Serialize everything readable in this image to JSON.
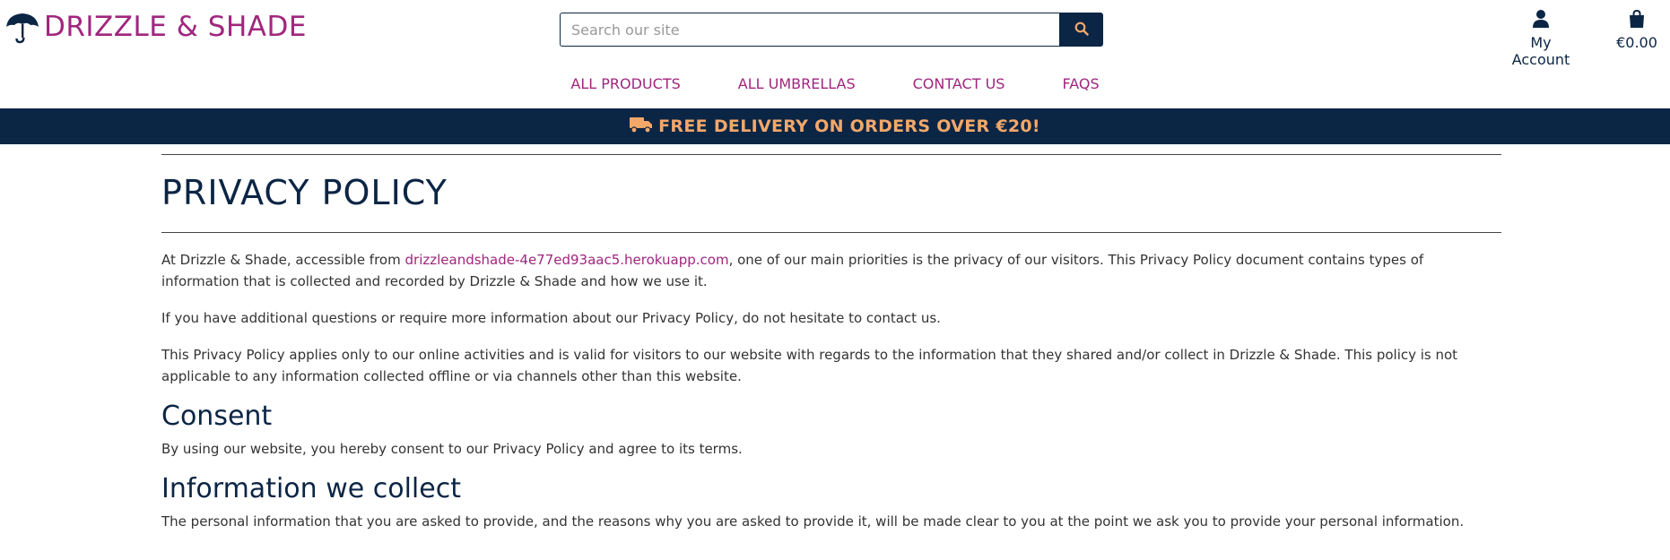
{
  "brand": {
    "name": "DRIZZLE & SHADE",
    "color": "#a0267e"
  },
  "search": {
    "placeholder": "Search our site",
    "value": ""
  },
  "account": {
    "label": "My Account"
  },
  "bag": {
    "total": "€0.00"
  },
  "nav": {
    "items": [
      {
        "label": "ALL PRODUCTS"
      },
      {
        "label": "ALL UMBRELLAS"
      },
      {
        "label": "CONTACT US"
      },
      {
        "label": "FAQS"
      }
    ]
  },
  "banner": {
    "text": "FREE DELIVERY ON ORDERS OVER €20!",
    "icon": "truck-icon"
  },
  "page": {
    "title": "PRIVACY POLICY",
    "intro": {
      "before_link": "At Drizzle & Shade, accessible from ",
      "link": "drizzleandshade-4e77ed93aac5.herokuapp.com",
      "after_link": ", one of our main priorities is the privacy of our visitors. This Privacy Policy document contains types of information that is collected and recorded by Drizzle & Shade and how we use it."
    },
    "para2": "If you have additional questions or require more information about our Privacy Policy, do not hesitate to contact us.",
    "para3": "This Privacy Policy applies only to our online activities and is valid for visitors to our website with regards to the information that they shared and/or collect in Drizzle & Shade. This policy is not applicable to any information collected offline or via channels other than this website.",
    "sections": [
      {
        "heading": "Consent",
        "text": "By using our website, you hereby consent to our Privacy Policy and agree to its terms."
      },
      {
        "heading": "Information we collect",
        "text": "The personal information that you are asked to provide, and the reasons why you are asked to provide it, will be made clear to you at the point we ask you to provide your personal information."
      }
    ]
  },
  "colors": {
    "navy": "#0b2545",
    "accent": "#a0267e",
    "banner_text": "#f3a86a"
  }
}
